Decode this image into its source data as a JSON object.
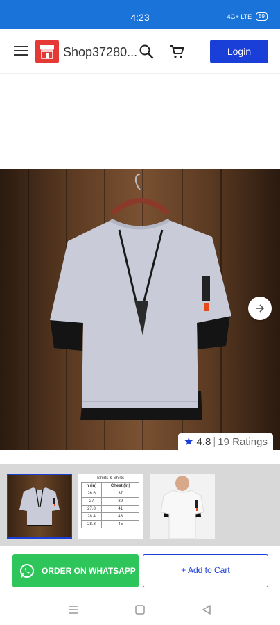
{
  "status_bar": {
    "time": "4:23",
    "indicators": "4G+  LTE",
    "battery": "59"
  },
  "header": {
    "shop_name": "Shop37280...",
    "login_label": "Login"
  },
  "rating": {
    "value": "4.8",
    "separator": "|",
    "count": "19 Ratings"
  },
  "size_chart": {
    "title": "Tshirts & Shirts",
    "columns": [
      "h (in)",
      "Chest (in)"
    ],
    "rows": [
      [
        "26.6",
        "37"
      ],
      [
        "27",
        "39"
      ],
      [
        "27.8",
        "41"
      ],
      [
        "28.4",
        "43"
      ],
      [
        "28.3",
        "45"
      ]
    ]
  },
  "actions": {
    "whatsapp_label": "ORDER ON WHATSAPP",
    "add_to_cart_label": "+ Add to Cart"
  },
  "colors": {
    "status_bar": "#1a73d9",
    "primary": "#1a3ed8",
    "whatsapp": "#2ec65a",
    "logo": "#e53935"
  }
}
